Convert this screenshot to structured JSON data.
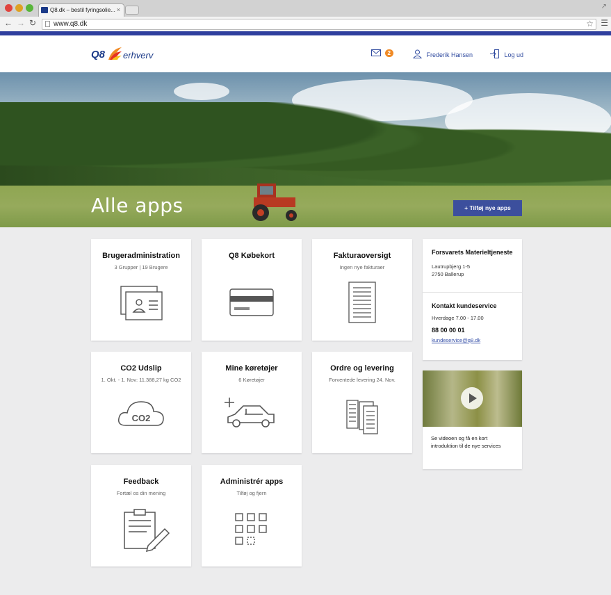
{
  "browser": {
    "tab_title": "Q8.dk – bestil fyringsolie...",
    "tab_close": "×",
    "url": "www.q8.dk"
  },
  "header": {
    "logo_text": "Q8",
    "logo_sub": "erhverv",
    "messages_count": "2",
    "user_name": "Frederik Hansen",
    "logout_label": "Log ud"
  },
  "hero": {
    "title": "Alle apps",
    "add_button": "+ Tilføj nye apps"
  },
  "apps": [
    {
      "title": "Brugeradministration",
      "subtitle": "3 Grupper | 19 Brugere",
      "icon": "id-card-icon"
    },
    {
      "title": "Q8 Købekort",
      "subtitle": "",
      "icon": "credit-card-icon"
    },
    {
      "title": "Fakturaoversigt",
      "subtitle": "Ingen nye fakturaer",
      "icon": "invoice-list-icon"
    },
    {
      "title": "CO2 Udslip",
      "subtitle": "1. Okt. - 1. Nov: 11.388,27 kg CO2",
      "icon": "co2-cloud-icon",
      "icon_text": "CO2"
    },
    {
      "title": "Mine køretøjer",
      "subtitle": "6 Køretøjer",
      "icon": "car-add-icon"
    },
    {
      "title": "Ordre og levering",
      "subtitle": "Forventede levering 24. Nov.",
      "icon": "order-documents-icon"
    },
    {
      "title": "Feedback",
      "subtitle": "Fortæl os din mening",
      "icon": "clipboard-pencil-icon"
    },
    {
      "title": "Administrér apps",
      "subtitle": "Tilføj og fjern",
      "icon": "app-grid-icon"
    }
  ],
  "company": {
    "name": "Forsvarets Materieltjeneste",
    "address1": "Lautrupbjerg 1-5",
    "address2": "2750 Ballerup"
  },
  "support": {
    "title": "Kontakt kundeservice",
    "hours": "Hverdage 7.00 - 17.00",
    "phone": "88 00 00 01",
    "email": "kundeservice@q8.dk"
  },
  "video": {
    "caption": "Se videoen og få en kort introduktion til de nye services"
  },
  "colors": {
    "brand_blue": "#2f3f9e",
    "badge_orange": "#f08a25",
    "background": "#ececed"
  }
}
